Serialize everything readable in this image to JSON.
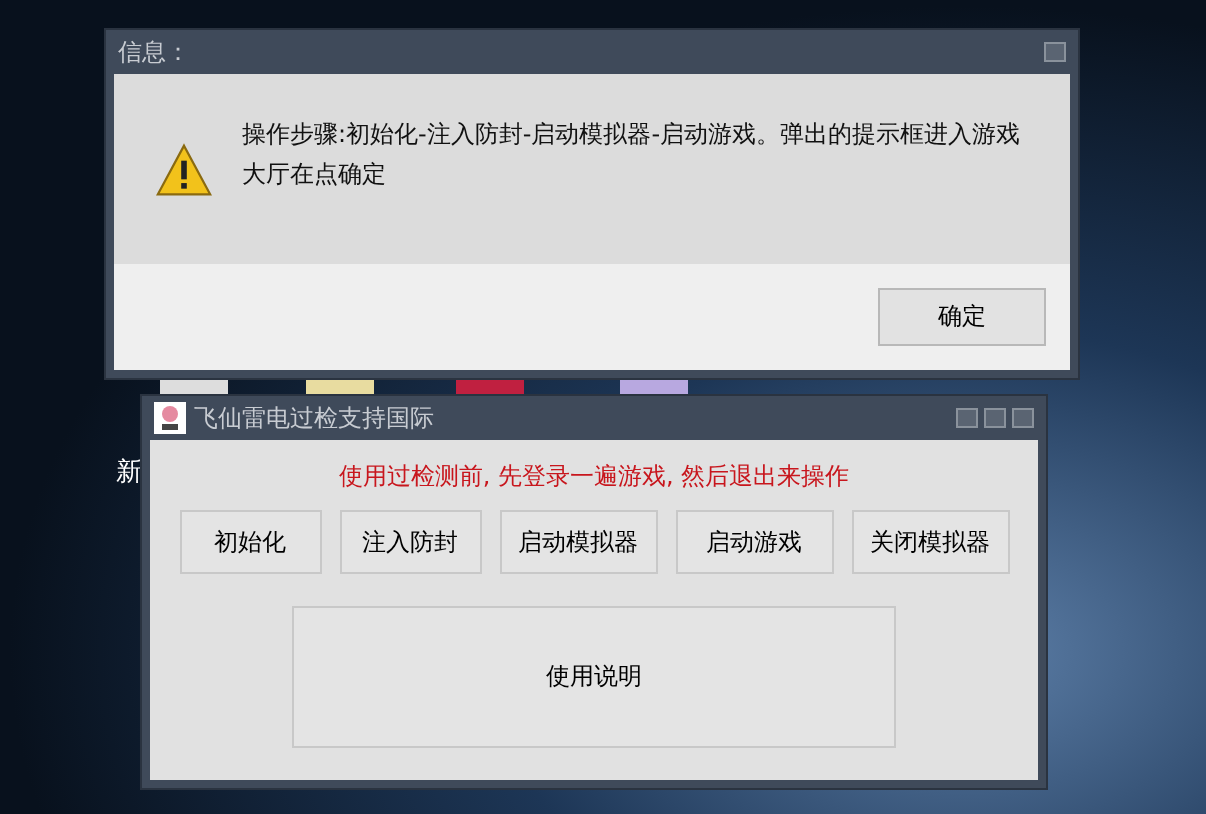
{
  "desktop": {
    "icon_label": "新"
  },
  "dialog": {
    "title": "信息：",
    "message": "操作步骤:初始化-注入防封-启动模拟器-启动游戏。弹出的提示框进入游戏大厅在点确定",
    "buttons": [
      "确定"
    ]
  },
  "main_window": {
    "title": "飞仙雷电过检支持国际",
    "notice": "使用过检测前, 先登录一遍游戏, 然后退出来操作",
    "buttons": [
      "初始化",
      "注入防封",
      "启动模拟器",
      "启动游戏",
      "关闭模拟器"
    ],
    "help_button": "使用说明"
  }
}
